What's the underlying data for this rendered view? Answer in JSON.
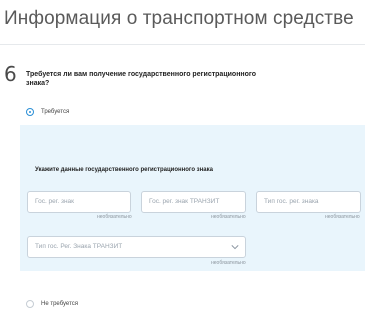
{
  "page": {
    "title": "Информация о транспортном средстве"
  },
  "step": {
    "number": "6",
    "question": "Требуется ли вам получение государственного регистрационного знака?"
  },
  "options": {
    "required": {
      "label": "Требуется",
      "selected": true
    },
    "not_required": {
      "label": "Не требуется",
      "selected": false
    }
  },
  "plate_section": {
    "title": "Укажите данные государственного регистрационного знака",
    "fields": {
      "plate_number": {
        "placeholder": "Гос. рег. знак",
        "hint": "необязательно"
      },
      "transit_number": {
        "placeholder": "Гос. рег. знак ТРАНЗИТ",
        "hint": "необязательно"
      },
      "plate_type": {
        "placeholder": "Тип гос. рег. знака",
        "hint": "необязательно"
      },
      "transit_type": {
        "placeholder": "Тип гос. Рег. Знака ТРАНЗИТ",
        "hint": "необязательно"
      }
    }
  }
}
